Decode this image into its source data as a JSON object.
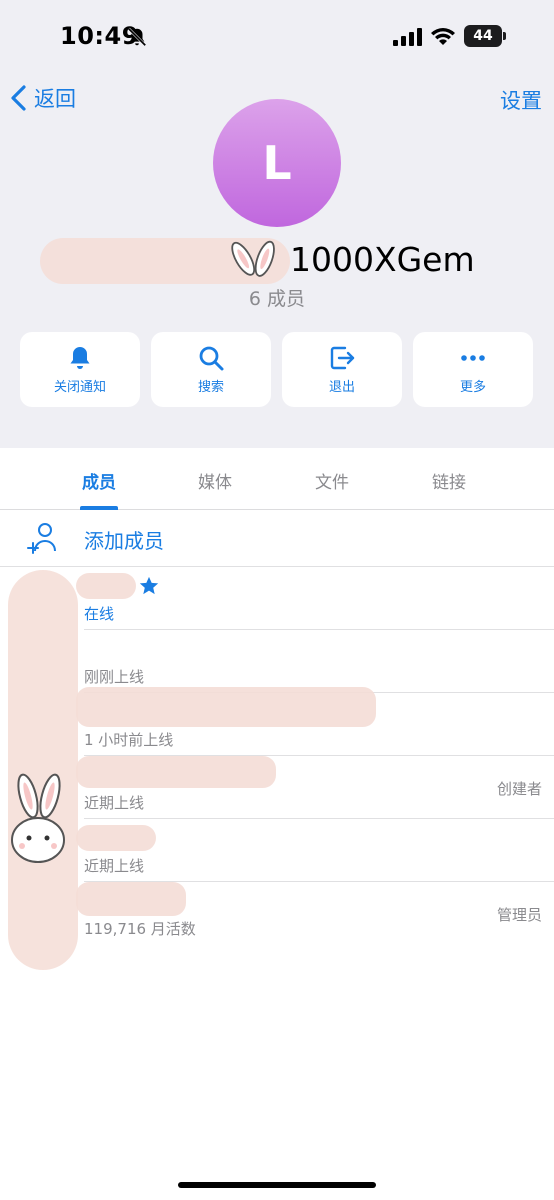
{
  "status_bar": {
    "time": "10:49",
    "battery": "44"
  },
  "nav": {
    "back_label": "返回",
    "settings_label": "设置"
  },
  "group": {
    "avatar_letter": "L",
    "title_visible": "1000XGem",
    "member_count": "6 成员"
  },
  "actions": [
    {
      "label": "关闭通知",
      "icon": "bell-icon"
    },
    {
      "label": "搜索",
      "icon": "search-icon"
    },
    {
      "label": "退出",
      "icon": "exit-icon"
    },
    {
      "label": "更多",
      "icon": "more-icon"
    }
  ],
  "tabs": [
    "成员",
    "媒体",
    "文件",
    "链接"
  ],
  "add_member_label": "添加成员",
  "members": [
    {
      "status": "在线",
      "role": ""
    },
    {
      "status": "刚刚上线",
      "role": ""
    },
    {
      "status": "1 小时前上线",
      "role": ""
    },
    {
      "status": "近期上线",
      "role": "创建者"
    },
    {
      "status": "近期上线",
      "role": ""
    },
    {
      "status": "119,716 月活数",
      "role": "管理员"
    }
  ],
  "colors": {
    "accent": "#1a7de2",
    "background": "#efeff4",
    "avatar_gradient_top": "#dca2ea",
    "avatar_gradient_bottom": "#c067de",
    "redaction": "#f4ddd6"
  }
}
